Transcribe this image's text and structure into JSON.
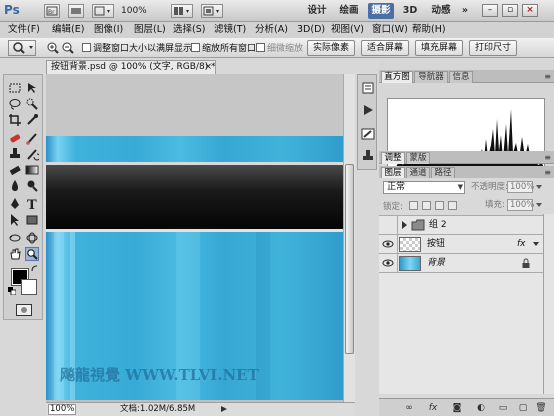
{
  "app": {
    "logo": "Ps",
    "zoom": "100%",
    "workspaces": [
      {
        "label": "设计",
        "active": false
      },
      {
        "label": "绘画",
        "active": false
      },
      {
        "label": "摄影",
        "active": true
      },
      {
        "label": "3D",
        "active": false
      },
      {
        "label": "动感",
        "active": false
      }
    ],
    "more": "»"
  },
  "menu": [
    "文件(F)",
    "编辑(E)",
    "图像(I)",
    "图层(L)",
    "选择(S)",
    "滤镜(T)",
    "分析(A)",
    "3D(D)",
    "视图(V)",
    "窗口(W)",
    "帮助(H)"
  ],
  "options": {
    "checks": [
      {
        "label": "调整窗口大小以满屏显示",
        "enabled": true
      },
      {
        "label": "缩放所有窗口",
        "enabled": true
      },
      {
        "label": "细微缩放",
        "enabled": false
      }
    ],
    "buttons": [
      "实际像素",
      "适合屏幕",
      "填充屏幕",
      "打印尺寸"
    ]
  },
  "document": {
    "tab_title": "按钮背景.psd @ 100% (文字, RGB/8) *",
    "close": "×",
    "watermark": "飚龍視覺 WWW.TLVI.NET",
    "zoom": "100%",
    "info": "文档:1.02M/6.85M"
  },
  "panels": {
    "top_tabs": [
      "直方图",
      "导航器",
      "信息"
    ],
    "mid_tabs": [
      "调整",
      "蒙版"
    ],
    "layer_tabs": [
      "图层",
      "通道",
      "路径"
    ],
    "blend_mode": "正常",
    "opacity_label": "不透明度:",
    "opacity": "100%",
    "lock_label": "锁定:",
    "fill_label": "填充:",
    "fill": "100%",
    "layers": [
      {
        "name": "组 2",
        "type": "group",
        "visible": false
      },
      {
        "name": "按钮",
        "type": "layer",
        "visible": true,
        "fx": "fx"
      },
      {
        "name": "背景",
        "type": "background",
        "visible": true
      }
    ]
  },
  "colors": {
    "accent": "#4b6fa2",
    "canvas_blue": "#3fb3d8",
    "glow_orange": "#f0a020"
  }
}
